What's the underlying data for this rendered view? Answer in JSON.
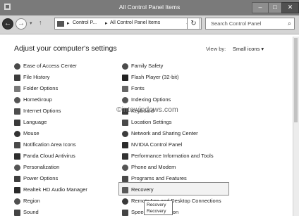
{
  "window": {
    "title": "All Control Panel Items",
    "min": "‒",
    "max": "□",
    "close": "✕"
  },
  "nav": {
    "back": "←",
    "forward": "→",
    "recent": "▾",
    "up": "↑",
    "breadcrumb": [
      "Control P...",
      "All Control Panel Items"
    ],
    "sep": "▸",
    "dropdown": "⌄",
    "refresh": "↻",
    "search_placeholder": "Search Control Panel",
    "search_icon": "⌕"
  },
  "header": {
    "title": "Adjust your computer's settings",
    "view_by": "View by:",
    "view_value": "Small icons ▾"
  },
  "items_left": [
    {
      "label": "Ease of Access Center",
      "icon": "ease-of-access-icon",
      "color": "#4a4a4a"
    },
    {
      "label": "File History",
      "icon": "file-history-icon",
      "color": "#3c3c3c"
    },
    {
      "label": "Folder Options",
      "icon": "folder-options-icon",
      "color": "#7a7a7a"
    },
    {
      "label": "HomeGroup",
      "icon": "homegroup-icon",
      "color": "#555555"
    },
    {
      "label": "Internet Options",
      "icon": "internet-options-icon",
      "color": "#4d4d4d"
    },
    {
      "label": "Language",
      "icon": "language-icon",
      "color": "#3a3a3a"
    },
    {
      "label": "Mouse",
      "icon": "mouse-icon",
      "color": "#333333"
    },
    {
      "label": "Notification Area Icons",
      "icon": "notification-area-icon",
      "color": "#4a4a4a"
    },
    {
      "label": "Panda Cloud Antivirus",
      "icon": "panda-antivirus-icon",
      "color": "#2e2e2e"
    },
    {
      "label": "Personalization",
      "icon": "personalization-icon",
      "color": "#555555"
    },
    {
      "label": "Power Options",
      "icon": "power-options-icon",
      "color": "#3e3e3e"
    },
    {
      "label": "Realtek HD Audio Manager",
      "icon": "realtek-audio-icon",
      "color": "#2a2a2a"
    },
    {
      "label": "Region",
      "icon": "region-icon",
      "color": "#505050"
    },
    {
      "label": "Sound",
      "icon": "sound-icon",
      "color": "#444444"
    }
  ],
  "items_right": [
    {
      "label": "Family Safety",
      "icon": "family-safety-icon",
      "color": "#4c4c4c"
    },
    {
      "label": "Flash Player (32-bit)",
      "icon": "flash-player-icon",
      "color": "#222222"
    },
    {
      "label": "Fonts",
      "icon": "fonts-icon",
      "color": "#666666"
    },
    {
      "label": "Indexing Options",
      "icon": "indexing-options-icon",
      "color": "#555555"
    },
    {
      "label": "Keyboard",
      "icon": "keyboard-icon",
      "color": "#3a3a3a"
    },
    {
      "label": "Location Settings",
      "icon": "location-settings-icon",
      "color": "#4a4a4a"
    },
    {
      "label": "Network and Sharing Center",
      "icon": "network-sharing-icon",
      "color": "#3c3c3c"
    },
    {
      "label": "NVIDIA Control Panel",
      "icon": "nvidia-icon",
      "color": "#2c2c2c"
    },
    {
      "label": "Performance Information and Tools",
      "icon": "performance-icon",
      "color": "#333333"
    },
    {
      "label": "Phone and Modem",
      "icon": "phone-modem-icon",
      "color": "#555555"
    },
    {
      "label": "Programs and Features",
      "icon": "programs-features-icon",
      "color": "#4a4a4a"
    },
    {
      "label": "Recovery",
      "icon": "recovery-icon",
      "color": "#5a5a5a"
    },
    {
      "label": "RemoteApp and Desktop Connections",
      "icon": "remoteapp-icon",
      "color": "#3a3a3a"
    },
    {
      "label": "Speech Recognition",
      "icon": "speech-recognition-icon",
      "color": "#444444"
    }
  ],
  "tooltip": [
    "Recovery",
    "Recovery"
  ],
  "watermark": "©intowindows.com"
}
